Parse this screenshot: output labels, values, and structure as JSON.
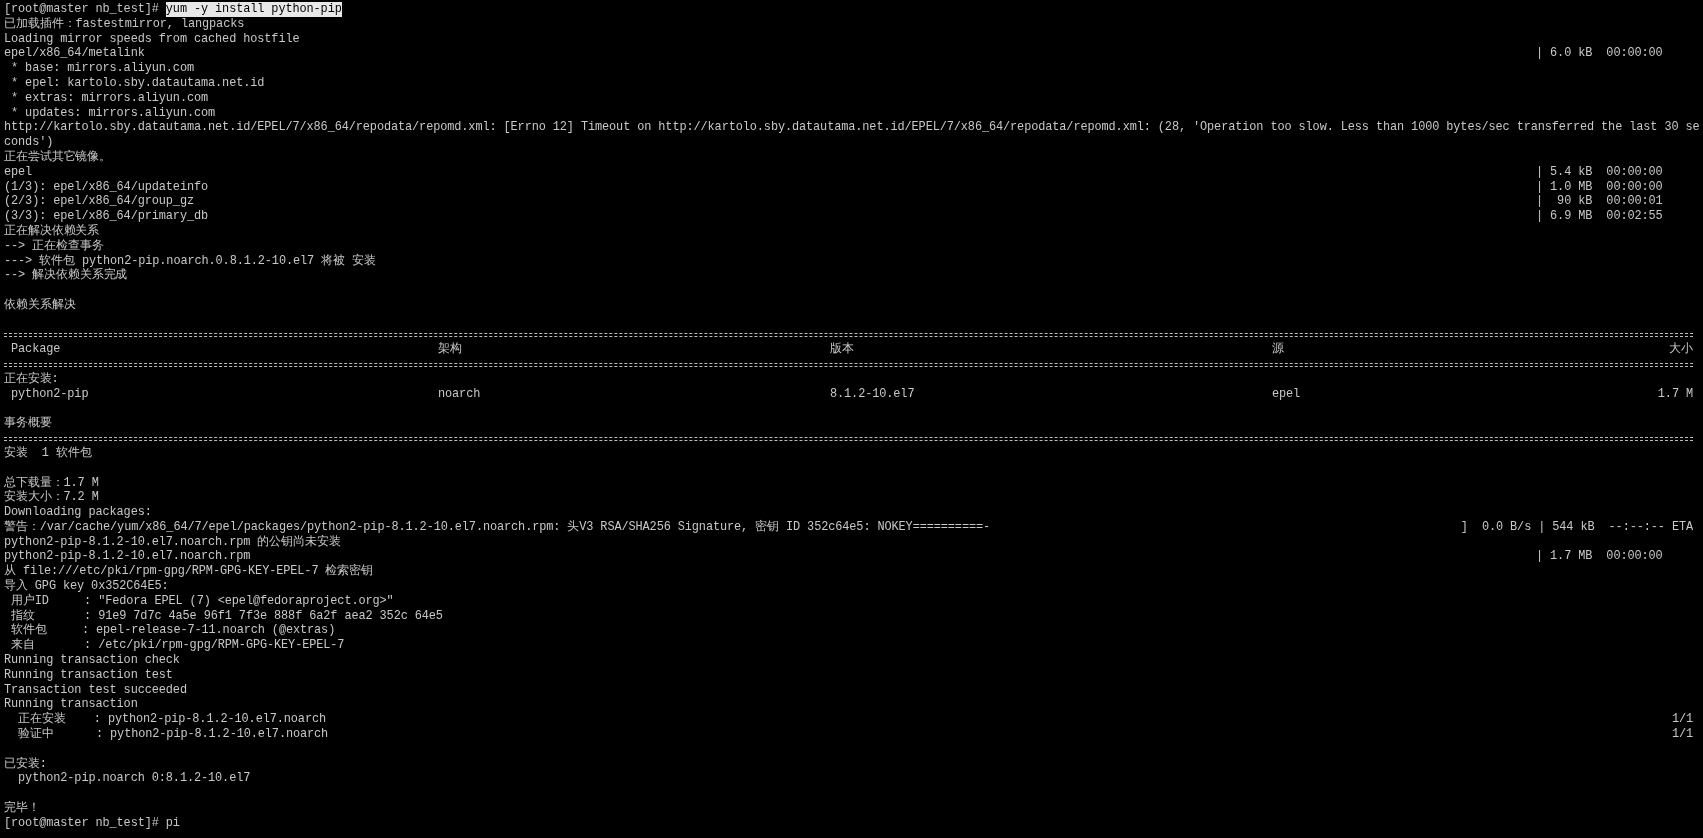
{
  "terminal": {
    "lines": [
      {
        "kind": "prompt",
        "prompt": "[root@master nb_test]# ",
        "command": "yum -y install python-pip",
        "selected": true
      },
      {
        "kind": "text",
        "text": "已加载插件：fastestmirror, langpacks"
      },
      {
        "kind": "text",
        "text": "Loading mirror speeds from cached hostfile"
      },
      {
        "kind": "progress",
        "text": "epel/x86_64/metalink",
        "info": "| 6.0 kB  00:00:00"
      },
      {
        "kind": "text",
        "text": " * base: mirrors.aliyun.com"
      },
      {
        "kind": "text",
        "text": " * epel: kartolo.sby.datautama.net.id"
      },
      {
        "kind": "text",
        "text": " * extras: mirrors.aliyun.com"
      },
      {
        "kind": "text",
        "text": " * updates: mirrors.aliyun.com"
      },
      {
        "kind": "text",
        "text": "http://kartolo.sby.datautama.net.id/EPEL/7/x86_64/repodata/repomd.xml: [Errno 12] Timeout on http://kartolo.sby.datautama.net.id/EPEL/7/x86_64/repodata/repomd.xml: (28, 'Operation too slow. Less than 1000 bytes/sec transferred the last 30 se"
      },
      {
        "kind": "text",
        "text": "conds')"
      },
      {
        "kind": "text",
        "text": "正在尝试其它镜像。"
      },
      {
        "kind": "progress",
        "text": "epel",
        "info": "| 5.4 kB  00:00:00"
      },
      {
        "kind": "progress",
        "text": "(1/3): epel/x86_64/updateinfo",
        "info": "| 1.0 MB  00:00:00"
      },
      {
        "kind": "progress",
        "text": "(2/3): epel/x86_64/group_gz",
        "info": "|  90 kB  00:00:01"
      },
      {
        "kind": "progress",
        "text": "(3/3): epel/x86_64/primary_db",
        "info": "| 6.9 MB  00:02:55"
      },
      {
        "kind": "text",
        "text": "正在解决依赖关系"
      },
      {
        "kind": "text",
        "text": "--> 正在检查事务"
      },
      {
        "kind": "text",
        "text": "---> 软件包 python2-pip.noarch.0.8.1.2-10.el7 将被 安装"
      },
      {
        "kind": "text",
        "text": "--> 解决依赖关系完成"
      },
      {
        "kind": "blank"
      },
      {
        "kind": "text",
        "text": "依赖关系解决"
      },
      {
        "kind": "blank"
      },
      {
        "kind": "rule"
      },
      {
        "kind": "table-header",
        "cells": [
          "Package",
          "架构",
          "版本",
          "源",
          "大小"
        ]
      },
      {
        "kind": "rule"
      },
      {
        "kind": "text",
        "text": "正在安装:"
      },
      {
        "kind": "table-row",
        "cells": [
          "python2-pip",
          "noarch",
          "8.1.2-10.el7",
          "epel",
          "1.7 M"
        ]
      },
      {
        "kind": "blank"
      },
      {
        "kind": "text",
        "text": "事务概要"
      },
      {
        "kind": "rule"
      },
      {
        "kind": "text",
        "text": "安装  1 软件包"
      },
      {
        "kind": "blank"
      },
      {
        "kind": "text",
        "text": "总下载量：1.7 M"
      },
      {
        "kind": "text",
        "text": "安装大小：7.2 M"
      },
      {
        "kind": "text",
        "text": "Downloading packages:"
      },
      {
        "kind": "status",
        "text": "警告：/var/cache/yum/x86_64/7/epel/packages/python2-pip-8.1.2-10.el7.noarch.rpm: 头V3 RSA/SHA256 Signature, 密钥 ID 352c64e5: NOKEY==========-",
        "info": "]  0.0 B/s | 544 kB  --:--:-- ETA"
      },
      {
        "kind": "text",
        "text": "python2-pip-8.1.2-10.el7.noarch.rpm 的公钥尚未安装"
      },
      {
        "kind": "progress",
        "text": "python2-pip-8.1.2-10.el7.noarch.rpm",
        "info": "| 1.7 MB  00:00:00"
      },
      {
        "kind": "text",
        "text": "从 file:///etc/pki/rpm-gpg/RPM-GPG-KEY-EPEL-7 检索密钥"
      },
      {
        "kind": "text",
        "text": "导入 GPG key 0x352C64E5:"
      },
      {
        "kind": "text",
        "text": " 用户ID     : \"Fedora EPEL (7) <epel@fedoraproject.org>\""
      },
      {
        "kind": "text",
        "text": " 指纹       : 91e9 7d7c 4a5e 96f1 7f3e 888f 6a2f aea2 352c 64e5"
      },
      {
        "kind": "text",
        "text": " 软件包     : epel-release-7-11.noarch (@extras)"
      },
      {
        "kind": "text",
        "text": " 来自       : /etc/pki/rpm-gpg/RPM-GPG-KEY-EPEL-7"
      },
      {
        "kind": "text",
        "text": "Running transaction check"
      },
      {
        "kind": "text",
        "text": "Running transaction test"
      },
      {
        "kind": "text",
        "text": "Transaction test succeeded"
      },
      {
        "kind": "text",
        "text": "Running transaction"
      },
      {
        "kind": "status",
        "text": "  正在安装    : python2-pip-8.1.2-10.el7.noarch",
        "info": "1/1"
      },
      {
        "kind": "status",
        "text": "  验证中      : python2-pip-8.1.2-10.el7.noarch",
        "info": "1/1"
      },
      {
        "kind": "blank"
      },
      {
        "kind": "text",
        "text": "已安装:"
      },
      {
        "kind": "text",
        "text": "  python2-pip.noarch 0:8.1.2-10.el7"
      },
      {
        "kind": "blank"
      },
      {
        "kind": "text",
        "text": "完毕！"
      },
      {
        "kind": "prompt",
        "prompt": "[root@master nb_test]# ",
        "command": "pi",
        "selected": false
      }
    ]
  }
}
